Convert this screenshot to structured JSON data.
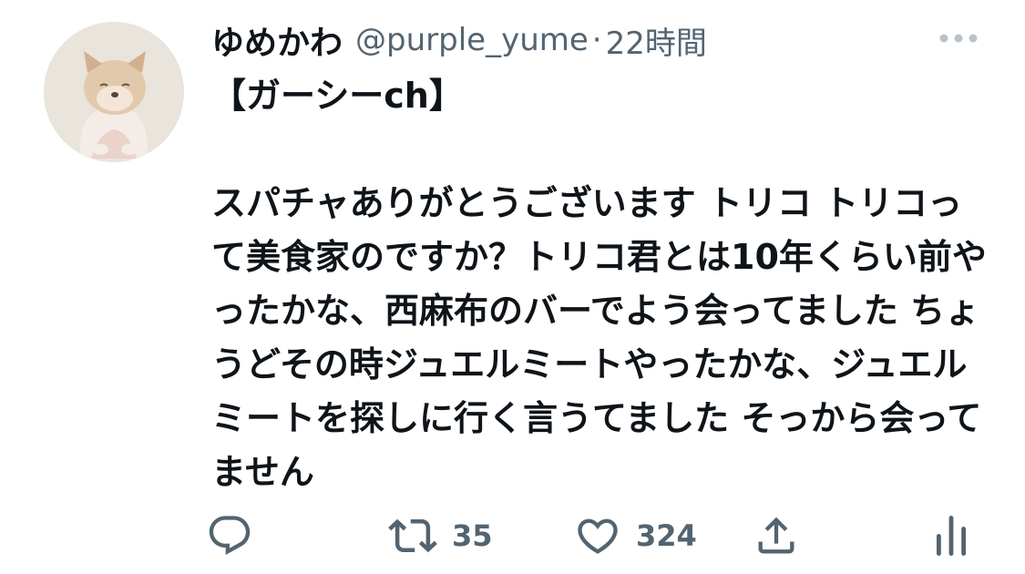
{
  "tweet": {
    "author": {
      "display_name": "ゆめかわ",
      "handle": "@purple_yume",
      "avatar_icon": "dog-avatar-icon"
    },
    "separator": "·",
    "time": "22時間",
    "text": "【ガーシーch】\n\nスパチャありがとうございます トリコ トリコって美食家のですか？トリコ君とは10年くらい前やったかな、西麻布のバーでよう会ってました ちょうどその時ジュエルミートやったかな、ジュエルミートを探しに行く言うてました そっから会ってません",
    "actions": {
      "reply": {
        "icon": "reply-icon"
      },
      "retweet": {
        "icon": "retweet-icon",
        "count": "35"
      },
      "like": {
        "icon": "heart-icon",
        "count": "324"
      },
      "share": {
        "icon": "share-icon"
      },
      "analytics": {
        "icon": "analytics-icon"
      }
    },
    "more_icon": "more-icon"
  },
  "colors": {
    "text": "#0f1419",
    "secondary": "#536471",
    "background": "#ffffff"
  }
}
